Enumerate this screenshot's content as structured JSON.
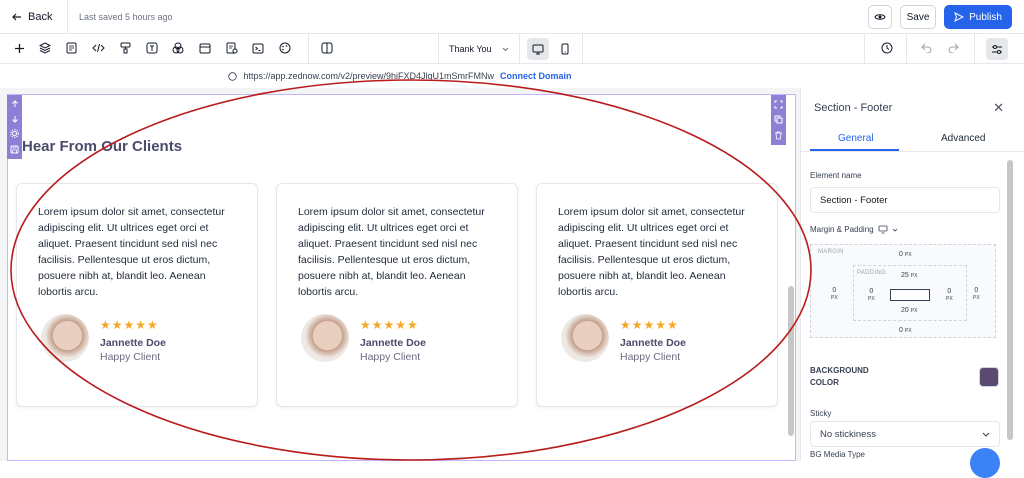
{
  "topbar": {
    "back_label": "Back",
    "saved_text": "Last saved 5 hours ago",
    "save_label": "Save",
    "publish_label": "Publish"
  },
  "toolbar": {
    "page_selector": "Thank You"
  },
  "url_bar": {
    "url": "https://app.zednow.com/v2/preview/9hiFXD4JlgU1mSmrFMNw",
    "connect_label": "Connect Domain"
  },
  "section": {
    "heading": "Hear From Our Clients",
    "testimonials": [
      {
        "text": "Lorem ipsum dolor sit amet, consectetur adipiscing elit. Ut ultrices eget orci et aliquet. Praesent tincidunt sed nisl nec facilisis. Pellentesque ut eros dictum, posuere nibh at, blandit leo. Aenean lobortis arcu.",
        "stars": "★★★★★",
        "name": "Jannette Doe",
        "role": "Happy Client"
      },
      {
        "text": "Lorem ipsum dolor sit amet, consectetur adipiscing elit. Ut ultrices eget orci et aliquet. Praesent tincidunt sed nisl nec facilisis. Pellentesque ut eros dictum, posuere nibh at, blandit leo. Aenean lobortis arcu.",
        "stars": "★★★★★",
        "name": "Jannette Doe",
        "role": "Happy Client"
      },
      {
        "text": "Lorem ipsum dolor sit amet, consectetur adipiscing elit. Ut ultrices eget orci et aliquet. Praesent tincidunt sed nisl nec facilisis. Pellentesque ut eros dictum, posuere nibh at, blandit leo. Aenean lobortis arcu.",
        "stars": "★★★★★",
        "name": "Jannette Doe",
        "role": "Happy Client"
      }
    ]
  },
  "panel": {
    "title": "Section - Footer",
    "tab_general": "General",
    "tab_advanced": "Advanced",
    "element_name_label": "Element name",
    "element_name_value": "Section - Footer",
    "margin_padding_label": "Margin & Padding",
    "margin_label": "MARGIN",
    "padding_label": "PADDING",
    "margin_top": "0",
    "margin_bottom": "0",
    "margin_left": "0",
    "margin_right": "0",
    "padding_top": "25",
    "padding_bottom": "20",
    "padding_left": "0",
    "padding_right": "0",
    "unit": "PX",
    "background_color_label_1": "BACKGROUND",
    "background_color_label_2": "COLOR",
    "background_color": "#5a4a72",
    "sticky_label": "Sticky",
    "sticky_value": "No stickiness",
    "bg_media_label": "BG Media Type"
  },
  "colors": {
    "accent": "#2563eb",
    "selection": "#8b7fd6",
    "annotation": "#b91c1c",
    "stars": "#f5a623"
  }
}
